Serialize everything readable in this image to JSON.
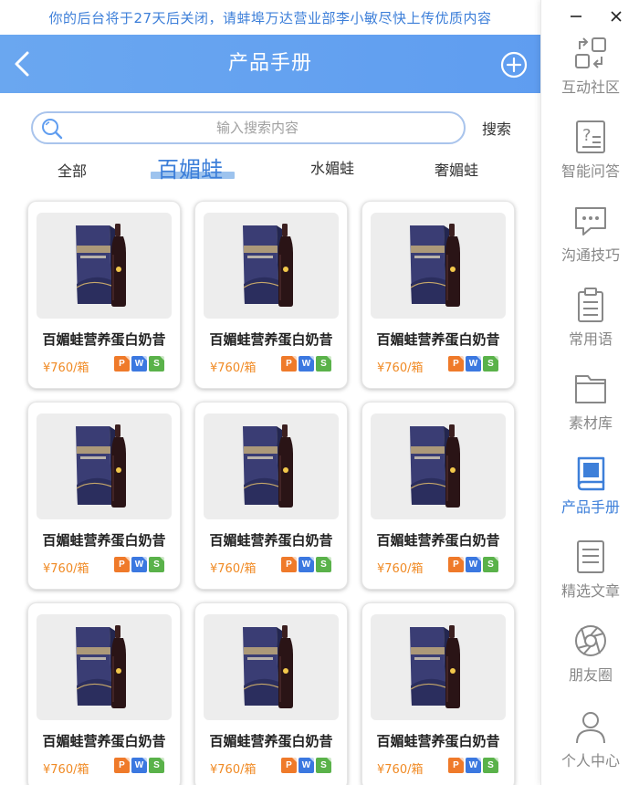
{
  "notice": "你的后台将于27天后关闭，请蚌埠万达营业部李小敏尽快上传优质内容",
  "header": {
    "title": "产品手册"
  },
  "search": {
    "placeholder": "输入搜索内容",
    "button_label": "搜索"
  },
  "tabs": [
    {
      "label": "全部",
      "active": false
    },
    {
      "label": "百媚蛙",
      "active": true
    },
    {
      "label": "水媚蛙",
      "active": false
    },
    {
      "label": "奢媚蛙",
      "active": false
    }
  ],
  "products": [
    {
      "name": "百媚蛙营养蛋白奶昔",
      "price": "¥760/箱",
      "files": [
        "P",
        "W",
        "S"
      ]
    },
    {
      "name": "百媚蛙营养蛋白奶昔",
      "price": "¥760/箱",
      "files": [
        "P",
        "W",
        "S"
      ]
    },
    {
      "name": "百媚蛙营养蛋白奶昔",
      "price": "¥760/箱",
      "files": [
        "P",
        "W",
        "S"
      ]
    },
    {
      "name": "百媚蛙营养蛋白奶昔",
      "price": "¥760/箱",
      "files": [
        "P",
        "W",
        "S"
      ]
    },
    {
      "name": "百媚蛙营养蛋白奶昔",
      "price": "¥760/箱",
      "files": [
        "P",
        "W",
        "S"
      ]
    },
    {
      "name": "百媚蛙营养蛋白奶昔",
      "price": "¥760/箱",
      "files": [
        "P",
        "W",
        "S"
      ]
    },
    {
      "name": "百媚蛙营养蛋白奶昔",
      "price": "¥760/箱",
      "files": [
        "P",
        "W",
        "S"
      ]
    },
    {
      "name": "百媚蛙营养蛋白奶昔",
      "price": "¥760/箱",
      "files": [
        "P",
        "W",
        "S"
      ]
    },
    {
      "name": "百媚蛙营养蛋白奶昔",
      "price": "¥760/箱",
      "files": [
        "P",
        "W",
        "S"
      ]
    }
  ],
  "sidebar": {
    "items": [
      {
        "label": "互动社区",
        "icon": "community-icon",
        "active": false
      },
      {
        "label": "智能问答",
        "icon": "qa-icon",
        "active": false
      },
      {
        "label": "沟通技巧",
        "icon": "chat-icon",
        "active": false
      },
      {
        "label": "常用语",
        "icon": "clipboard-icon",
        "active": false
      },
      {
        "label": "素材库",
        "icon": "folder-icon",
        "active": false
      },
      {
        "label": "产品手册",
        "icon": "book-icon",
        "active": true
      },
      {
        "label": "精选文章",
        "icon": "article-icon",
        "active": false
      },
      {
        "label": "朋友圈",
        "icon": "aperture-icon",
        "active": false
      },
      {
        "label": "个人中心",
        "icon": "user-icon",
        "active": false
      }
    ]
  },
  "colors": {
    "accent": "#3d7fd9",
    "header": "#5f9df0",
    "price": "#f08a24"
  }
}
